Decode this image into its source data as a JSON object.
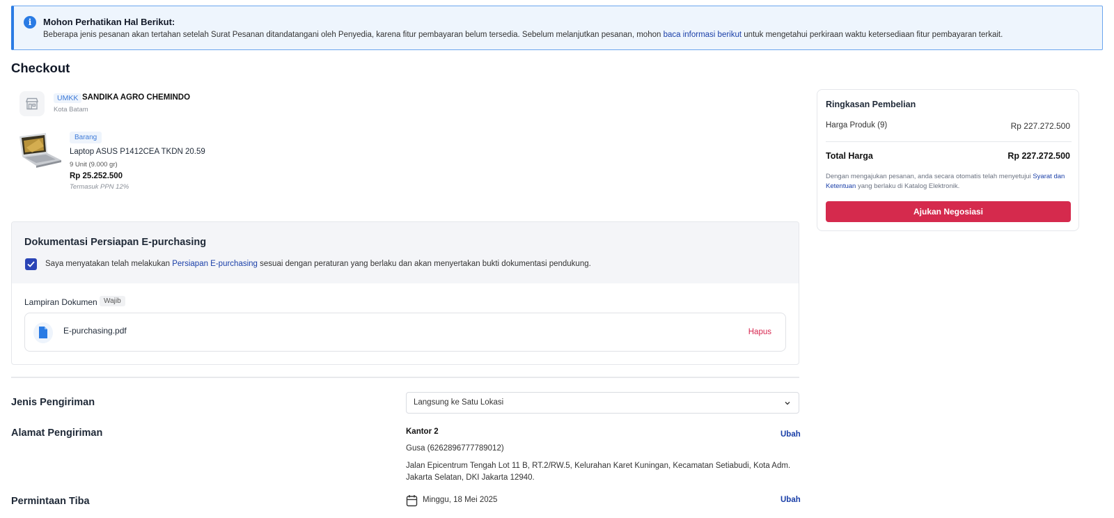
{
  "banner": {
    "title": "Mohon Perhatikan Hal Berikut:",
    "text_before": "Beberapa jenis pesanan akan tertahan setelah Surat Pesanan ditandatangani oleh Penyedia, karena fitur pembayaran belum tersedia. Sebelum melanjutkan pesanan, mohon ",
    "link": "baca informasi berikut",
    "text_after": " untuk mengetahui perkiraan waktu ketersediaan fitur pembayaran terkait.",
    "icon": "info-icon"
  },
  "page": {
    "title": "Checkout"
  },
  "store": {
    "badge": "UMKK",
    "name": "SANDIKA AGRO CHEMINDO",
    "city": "Kota Batam",
    "icon": "store-icon"
  },
  "product": {
    "badge": "Barang",
    "name": "Laptop ASUS P1412CEA TKDN 20.59",
    "qty": "9 Unit (9.000 gr)",
    "price": "Rp 25.252.500",
    "tax_note": "Termasuk PPN 12%"
  },
  "documentation": {
    "title": "Dokumentasi Persiapan E-purchasing",
    "checked": true,
    "check_text_before": "Saya menyatakan telah melakukan ",
    "check_link": "Persiapan E-purchasing",
    "check_text_after": " sesuai dengan peraturan yang berlaku dan akan menyertakan bukti dokumentasi pendukung.",
    "attachment_label": "Lampiran Dokumen",
    "required_badge": "Wajib",
    "file_name": "E-purchasing.pdf",
    "delete_label": "Hapus"
  },
  "shipping": {
    "type_label": "Jenis Pengiriman",
    "type_value": "Langsung ke Satu Lokasi",
    "address_label": "Alamat Pengiriman",
    "address_title": "Kantor 2",
    "address_contact": "Gusa (6262896777789012)",
    "address_street": "Jalan Epicentrum Tengah Lot 11 B, RT.2/RW.5, Kelurahan Karet Kuningan, Kecamatan Setiabudi, Kota Adm. Jakarta Selatan, DKI Jakarta 12940.",
    "change_label": "Ubah",
    "arrival_label": "Permintaan Tiba",
    "arrival_date": "Minggu, 18 Mei 2025"
  },
  "summary": {
    "title": "Ringkasan Pembelian",
    "product_price_label": "Harga Produk (9)",
    "product_price_value": "Rp 227.272.500",
    "total_label": "Total Harga",
    "total_value": "Rp 227.272.500",
    "terms_before": "Dengan mengajukan pesanan, anda secara otomatis telah menyetujui ",
    "terms_link": "Syarat dan Ketentuan",
    "terms_after": " yang berlaku di Katalog Elektronik.",
    "button_label": "Ajukan Negosiasi"
  },
  "colors": {
    "primary_blue": "#1a3fa8",
    "accent_red": "#d52a4d",
    "info_blue": "#2a7be4",
    "checkbox_blue": "#2a44b6"
  }
}
